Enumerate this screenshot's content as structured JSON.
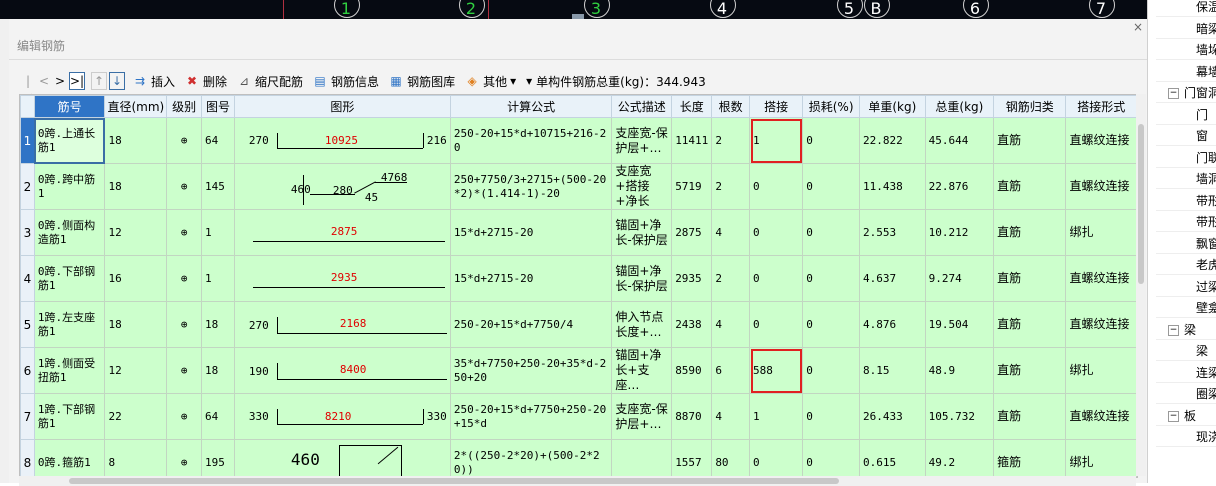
{
  "top_axes": [
    {
      "label": "1",
      "green": true
    },
    {
      "label": "2",
      "green": true
    },
    {
      "label": "3",
      "green": true
    },
    {
      "label": "4",
      "green": false
    },
    {
      "label": "5",
      "green": false
    },
    {
      "label": "B",
      "green": false
    },
    {
      "label": "6",
      "green": false
    },
    {
      "label": "7",
      "green": false
    }
  ],
  "panel": {
    "title": "编辑钢筋",
    "close": "×"
  },
  "toolbar": {
    "nav_first": "|<",
    "nav_prev": "<",
    "nav_next": ">",
    "nav_last": ">|",
    "insert": "插入",
    "delete": "删除",
    "scale_rebar": "缩尺配筋",
    "rebar_info": "钢筋信息",
    "rebar_library": "钢筋图库",
    "other": "其他",
    "other_arrow": "▾",
    "total_weight": "单构件钢筋总重(kg)：344.943"
  },
  "table": {
    "headers": [
      "筋号",
      "直径(mm)",
      "级别",
      "图号",
      "图形",
      "计算公式",
      "公式描述",
      "长度",
      "根数",
      "搭接",
      "损耗(%)",
      "单重(kg)",
      "总重(kg)",
      "钢筋归类",
      "搭接形式"
    ],
    "rows": [
      {
        "no": "1",
        "name": "0跨.上通长筋1",
        "dia": "18",
        "grade": "⊕",
        "fig": "64",
        "formula": "250-20+15*d+10715+216-20",
        "desc": "支座宽-保护层+…",
        "len": "11411",
        "count": "2",
        "lap": "1",
        "loss": "0",
        "unit": "22.822",
        "total": "45.644",
        "cls": "直筋",
        "lap_form": "直螺纹连接",
        "shape": {
          "left": "270",
          "mid": "10925",
          "right": "216"
        }
      },
      {
        "no": "2",
        "name": "0跨.跨中筋1",
        "dia": "18",
        "grade": "⊕",
        "fig": "145",
        "formula": "250+7750/3+2715+(500-20*2)*(1.414-1)-20",
        "desc": "支座宽+搭接+净长",
        "len": "5719",
        "count": "2",
        "lap": "0",
        "loss": "0",
        "unit": "11.438",
        "total": "22.876",
        "cls": "直筋",
        "lap_form": "直螺纹连接",
        "shape": {
          "a": "460",
          "b": "280",
          "c": "45",
          "d": "4768"
        }
      },
      {
        "no": "3",
        "name": "0跨.侧面构造筋1",
        "dia": "12",
        "grade": "⊕",
        "fig": "1",
        "formula": "15*d+2715-20",
        "desc": "锚固+净长-保护层",
        "len": "2875",
        "count": "4",
        "lap": "0",
        "loss": "0",
        "unit": "2.553",
        "total": "10.212",
        "cls": "直筋",
        "lap_form": "绑扎",
        "shape": {
          "mid": "2875"
        }
      },
      {
        "no": "4",
        "name": "0跨.下部钢筋1",
        "dia": "16",
        "grade": "⊕",
        "fig": "1",
        "formula": "15*d+2715-20",
        "desc": "锚固+净长-保护层",
        "len": "2935",
        "count": "2",
        "lap": "0",
        "loss": "0",
        "unit": "4.637",
        "total": "9.274",
        "cls": "直筋",
        "lap_form": "直螺纹连接",
        "shape": {
          "mid": "2935"
        }
      },
      {
        "no": "5",
        "name": "1跨.左支座筋1",
        "dia": "18",
        "grade": "⊕",
        "fig": "18",
        "formula": "250-20+15*d+7750/4",
        "desc": "伸入节点长度+…",
        "len": "2438",
        "count": "4",
        "lap": "0",
        "loss": "0",
        "unit": "4.876",
        "total": "19.504",
        "cls": "直筋",
        "lap_form": "直螺纹连接",
        "shape": {
          "left": "270",
          "mid": "2168"
        }
      },
      {
        "no": "6",
        "name": "1跨.侧面受扭筋1",
        "dia": "12",
        "grade": "⊕",
        "fig": "18",
        "formula": "35*d+7750+250-20+35*d-250+20",
        "desc": "锚固+净长+支座…",
        "len": "8590",
        "count": "6",
        "lap": "588",
        "loss": "0",
        "unit": "8.15",
        "total": "48.9",
        "cls": "直筋",
        "lap_form": "绑扎",
        "shape": {
          "left": "190",
          "mid": "8400"
        }
      },
      {
        "no": "7",
        "name": "1跨.下部钢筋1",
        "dia": "22",
        "grade": "⊕",
        "fig": "64",
        "formula": "250-20+15*d+7750+250-20+15*d",
        "desc": "支座宽-保护层+…",
        "len": "8870",
        "count": "4",
        "lap": "1",
        "loss": "0",
        "unit": "26.433",
        "total": "105.732",
        "cls": "直筋",
        "lap_form": "直螺纹连接",
        "shape": {
          "left": "330",
          "mid": "8210",
          "right": "330"
        }
      },
      {
        "no": "8",
        "name": "0跨.箍筋1",
        "dia": "8",
        "grade": "⊕",
        "fig": "195",
        "formula": "2*((250-2*20)+(500-2*20))",
        "desc": "",
        "len": "1557",
        "count": "80",
        "lap": "0",
        "loss": "0",
        "unit": "0.615",
        "total": "49.2",
        "cls": "箍筋",
        "lap_form": "绑扎",
        "shape": {
          "left": "460"
        }
      }
    ]
  },
  "tree": {
    "items": [
      {
        "label": "保温",
        "kind": "child"
      },
      {
        "label": "暗梁",
        "kind": "child"
      },
      {
        "label": "墙垛",
        "kind": "child"
      },
      {
        "label": "幕墙",
        "kind": "child"
      },
      {
        "label": "门窗洞",
        "kind": "group"
      },
      {
        "label": "门",
        "kind": "child"
      },
      {
        "label": "窗",
        "kind": "child"
      },
      {
        "label": "门联",
        "kind": "child"
      },
      {
        "label": "墙洞",
        "kind": "child"
      },
      {
        "label": "带形",
        "kind": "child"
      },
      {
        "label": "带形",
        "kind": "child"
      },
      {
        "label": "飘窗",
        "kind": "child"
      },
      {
        "label": "老虎",
        "kind": "child"
      },
      {
        "label": "过梁",
        "kind": "child"
      },
      {
        "label": "壁龛",
        "kind": "child"
      },
      {
        "label": "梁",
        "kind": "group"
      },
      {
        "label": "梁",
        "kind": "child"
      },
      {
        "label": "连梁",
        "kind": "child"
      },
      {
        "label": "圈梁",
        "kind": "child"
      },
      {
        "label": "板",
        "kind": "group"
      },
      {
        "label": "现浇",
        "kind": "child"
      }
    ],
    "collapse_glyph": "−"
  }
}
